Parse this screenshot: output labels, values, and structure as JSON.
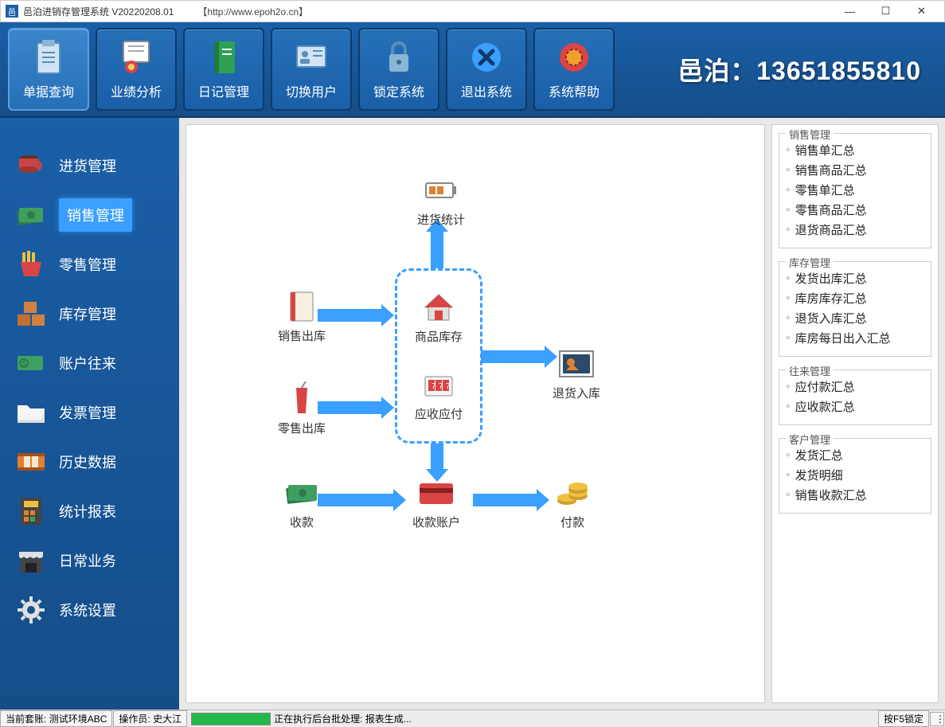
{
  "window": {
    "title": "邑泊进销存管理系统 V20220208.01",
    "url": "【http://www.epoh2o.cn】"
  },
  "toolbar": {
    "items": [
      {
        "label": "单据查询",
        "icon": "clipboard"
      },
      {
        "label": "业绩分析",
        "icon": "cert"
      },
      {
        "label": "日记管理",
        "icon": "book"
      },
      {
        "label": "切换用户",
        "icon": "id"
      },
      {
        "label": "锁定系统",
        "icon": "lock"
      },
      {
        "label": "退出系统",
        "icon": "close"
      },
      {
        "label": "系统帮助",
        "icon": "chip"
      }
    ],
    "brand": "邑泊：13651855810"
  },
  "sidebar": {
    "items": [
      {
        "label": "进货管理",
        "icon": "cup"
      },
      {
        "label": "销售管理",
        "icon": "money",
        "active": true
      },
      {
        "label": "零售管理",
        "icon": "fries"
      },
      {
        "label": "库存管理",
        "icon": "boxes"
      },
      {
        "label": "账户往来",
        "icon": "cash"
      },
      {
        "label": "发票管理",
        "icon": "folder"
      },
      {
        "label": "历史数据",
        "icon": "film"
      },
      {
        "label": "统计报表",
        "icon": "calc"
      },
      {
        "label": "日常业务",
        "icon": "shop"
      },
      {
        "label": "系统设置",
        "icon": "gear"
      }
    ]
  },
  "flow": {
    "nodes": {
      "stat": "进货统计",
      "sale_out": "销售出库",
      "retail_out": "零售出库",
      "goods_stock": "商品库存",
      "receivable": "应收应付",
      "return_in": "退货入库",
      "collect": "收款",
      "collect_acct": "收款账户",
      "pay": "付款"
    }
  },
  "panels": [
    {
      "title": "销售管理",
      "items": [
        "销售单汇总",
        "销售商品汇总",
        "零售单汇总",
        "零售商品汇总",
        "退货商品汇总"
      ]
    },
    {
      "title": "库存管理",
      "items": [
        "发货出库汇总",
        "库房库存汇总",
        "退货入库汇总",
        "库房每日出入汇总"
      ]
    },
    {
      "title": "往来管理",
      "items": [
        "应付款汇总",
        "应收款汇总"
      ]
    },
    {
      "title": "客户管理",
      "items": [
        "发货汇总",
        "发货明细",
        "销售收款汇总"
      ]
    }
  ],
  "statusbar": {
    "account_label": "当前套账:",
    "account_value": "测试环境ABC",
    "operator_label": "操作员:",
    "operator_value": "史大江",
    "task": "正在执行后台批处理: 报表生成...",
    "lock": "按F5锁定"
  }
}
